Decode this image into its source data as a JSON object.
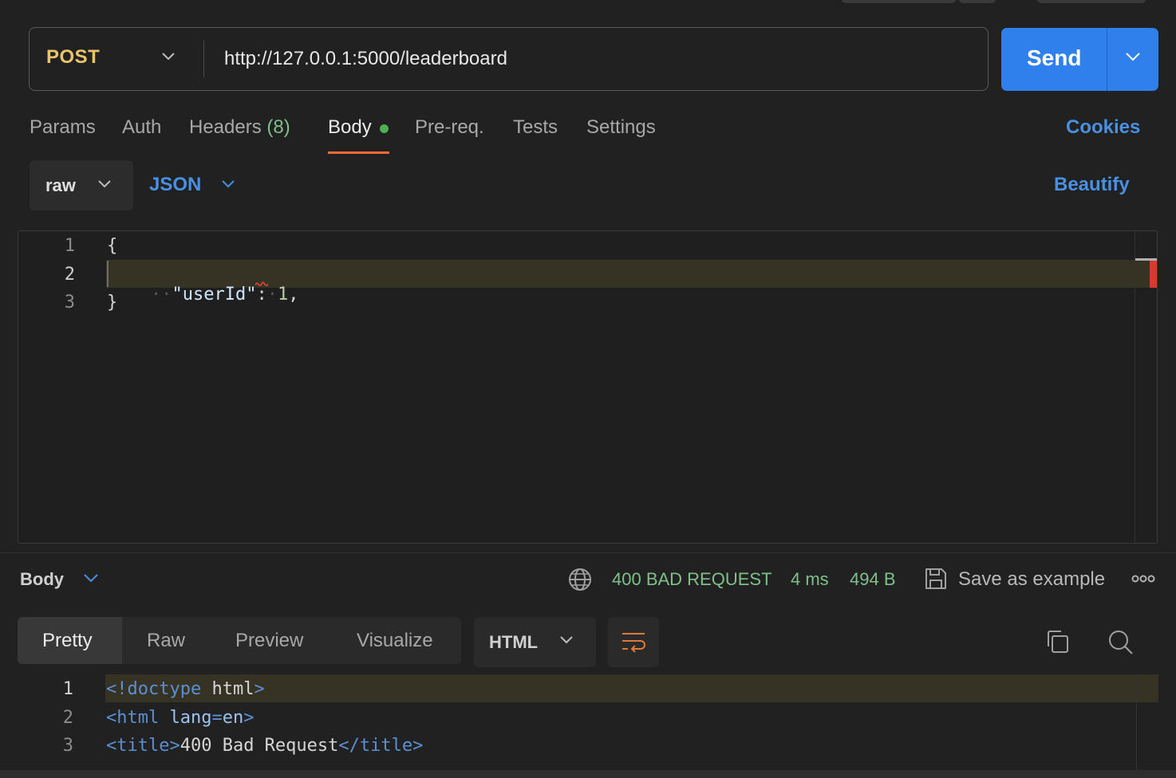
{
  "request": {
    "method": "POST",
    "url": "http://127.0.0.1:5000/leaderboard",
    "send_label": "Send"
  },
  "request_tabs": {
    "params": "Params",
    "auth": "Auth",
    "headers": "Headers",
    "headers_count": "(8)",
    "body": "Body",
    "prereq": "Pre-req.",
    "tests": "Tests",
    "settings": "Settings",
    "cookies": "Cookies",
    "active": "Body"
  },
  "body_options": {
    "mode": "raw",
    "language": "JSON",
    "beautify": "Beautify"
  },
  "request_editor": {
    "line_numbers": [
      "1",
      "2",
      "3"
    ],
    "line1": "{",
    "line2_indent": "··",
    "line2_key": "\"userId\"",
    "line2_colon": ":",
    "line2_space": "·",
    "line2_value": "1",
    "line2_comma": ",",
    "line3": "}"
  },
  "response": {
    "section_label": "Body",
    "status": "400 BAD REQUEST",
    "time": "4 ms",
    "size": "494 B",
    "save_label": "Save as example",
    "views": [
      "Pretty",
      "Raw",
      "Preview",
      "Visualize"
    ],
    "active_view": "Pretty",
    "format": "HTML",
    "line_numbers": [
      "1",
      "2",
      "3"
    ],
    "code": {
      "l1_open": "<!doctype",
      "l1_name": "html",
      "l1_close": ">",
      "l2_open": "<html",
      "l2_attr": "lang",
      "l2_eq": "=",
      "l2_val": "en",
      "l2_close": ">",
      "l3_open": "<title>",
      "l3_text": "400 Bad Request",
      "l3_close": "</title>"
    }
  },
  "colors": {
    "accent_blue": "#2f80ed",
    "method_yellow": "#e9c46a",
    "status_green": "#7fc08a",
    "tab_underline": "#f26b3a",
    "error_red": "#d83a2f"
  }
}
